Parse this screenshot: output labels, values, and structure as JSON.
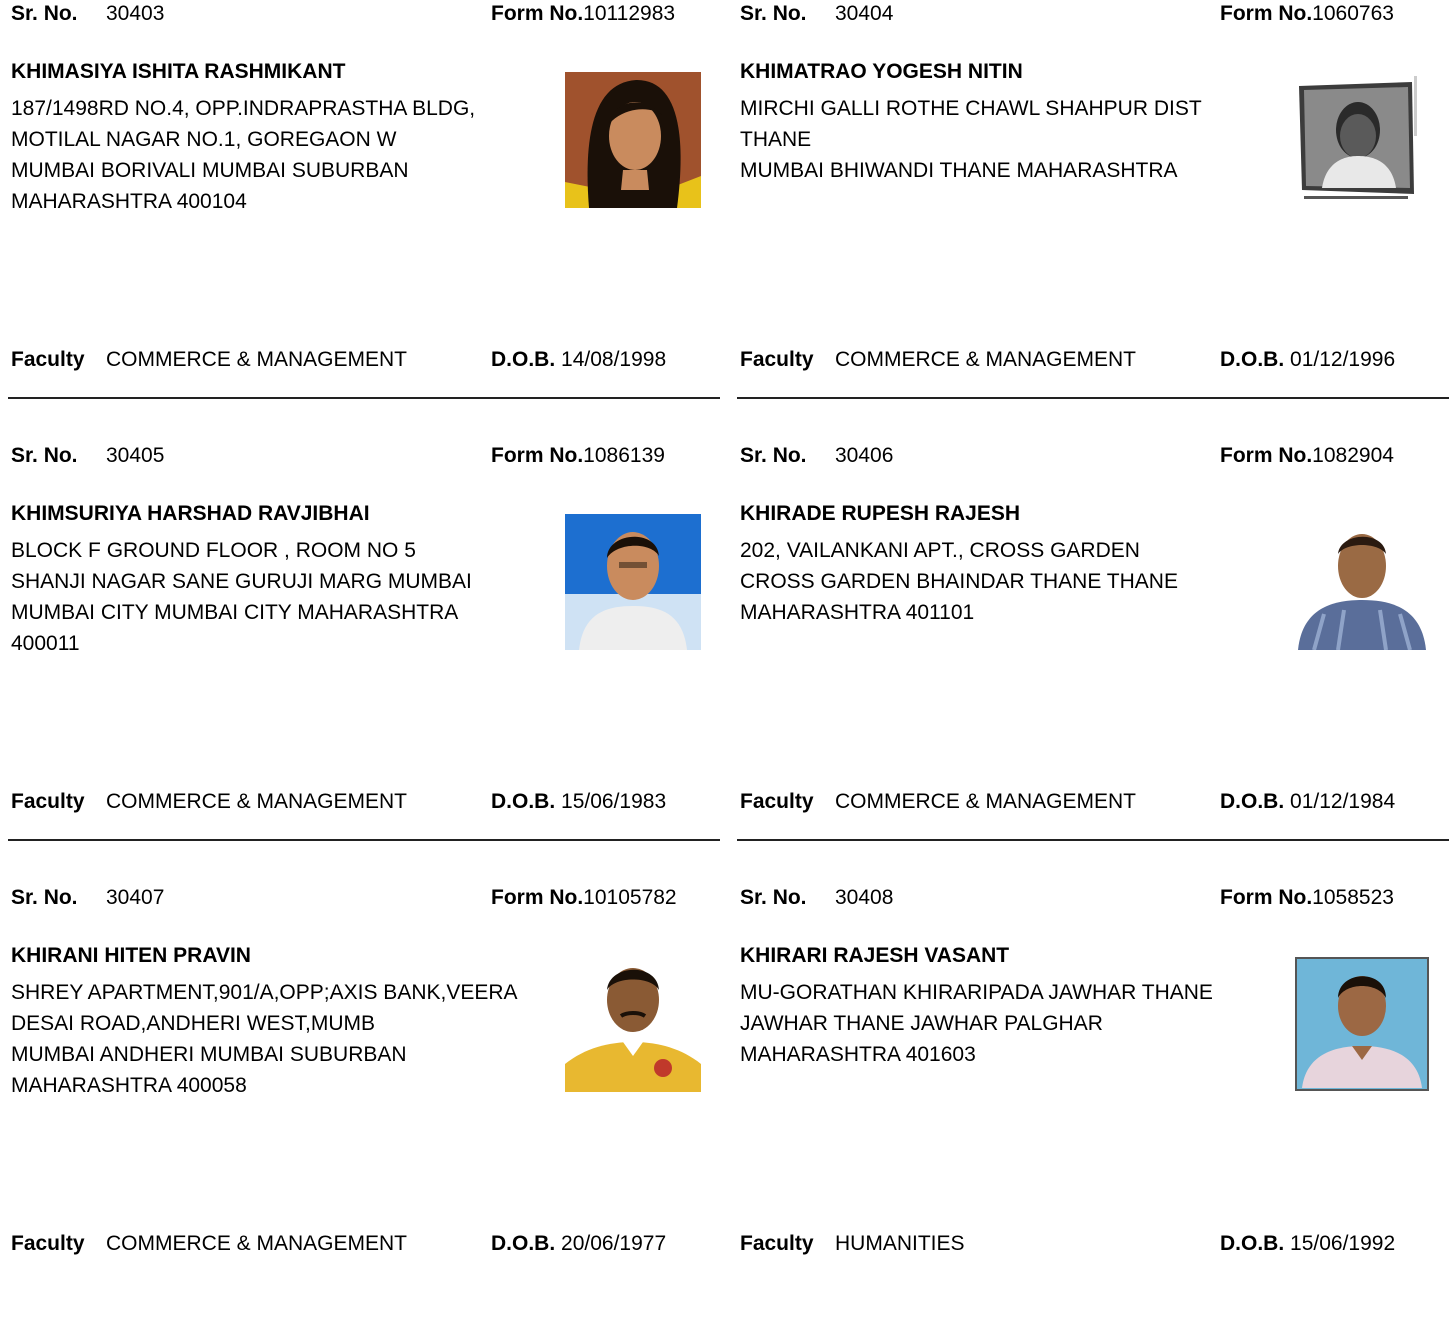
{
  "labels": {
    "sr_no": "Sr. No.",
    "form_no": "Form No.",
    "faculty": "Faculty",
    "dob": "D.O.B."
  },
  "records": [
    {
      "sr_no": "30403",
      "form_no": "10112983",
      "name": "KHIMASIYA ISHITA RASHMIKANT",
      "address": [
        "187/1498RD NO.4, OPP.INDRAPRASTHA BLDG,",
        "MOTILAL NAGAR NO.1, GOREGAON W",
        " MUMBAI BORIVALI MUMBAI SUBURBAN",
        "MAHARASHTRA 400104"
      ],
      "faculty": "COMMERCE & MANAGEMENT",
      "dob": "14/08/1998"
    },
    {
      "sr_no": "30404",
      "form_no": "1060763",
      "name": "KHIMATRAO YOGESH NITIN",
      "address": [
        "MIRCHI GALLI ROTHE CHAWL SHAHPUR DIST",
        "THANE",
        " MUMBAI BHIWANDI THANE MAHARASHTRA"
      ],
      "faculty": "COMMERCE & MANAGEMENT",
      "dob": "01/12/1996"
    },
    {
      "sr_no": "30405",
      "form_no": "1086139",
      "name": "KHIMSURIYA HARSHAD RAVJIBHAI",
      "address": [
        "BLOCK F GROUND FLOOR , ROOM NO 5",
        "SHANJI NAGAR SANE GURUJI MARG MUMBAI",
        "MUMBAI CITY MUMBAI CITY MAHARASHTRA",
        "400011"
      ],
      "faculty": "COMMERCE & MANAGEMENT",
      "dob": "15/06/1983"
    },
    {
      "sr_no": "30406",
      "form_no": "1082904",
      "name": "KHIRADE RUPESH RAJESH",
      "address": [
        "202, VAILANKANI APT., CROSS GARDEN",
        "CROSS GARDEN BHAINDAR THANE THANE",
        "MAHARASHTRA 401101"
      ],
      "faculty": "COMMERCE & MANAGEMENT",
      "dob": "01/12/1984"
    },
    {
      "sr_no": "30407",
      "form_no": "10105782",
      "name": "KHIRANI HITEN PRAVIN",
      "address": [
        "SHREY APARTMENT,901/A,OPP;AXIS BANK,VEERA",
        "DESAI ROAD,ANDHERI WEST,MUMB",
        " MUMBAI ANDHERI MUMBAI SUBURBAN",
        "MAHARASHTRA 400058"
      ],
      "faculty": "COMMERCE & MANAGEMENT",
      "dob": "20/06/1977"
    },
    {
      "sr_no": "30408",
      "form_no": "1058523",
      "name": "KHIRARI RAJESH VASANT",
      "address": [
        "MU-GORATHAN KHIRARIPADA JAWHAR THANE",
        "JAWHAR THANE JAWHAR PALGHAR",
        "MAHARASHTRA 401603"
      ],
      "faculty": "HUMANITIES",
      "dob": "15/06/1992"
    }
  ]
}
